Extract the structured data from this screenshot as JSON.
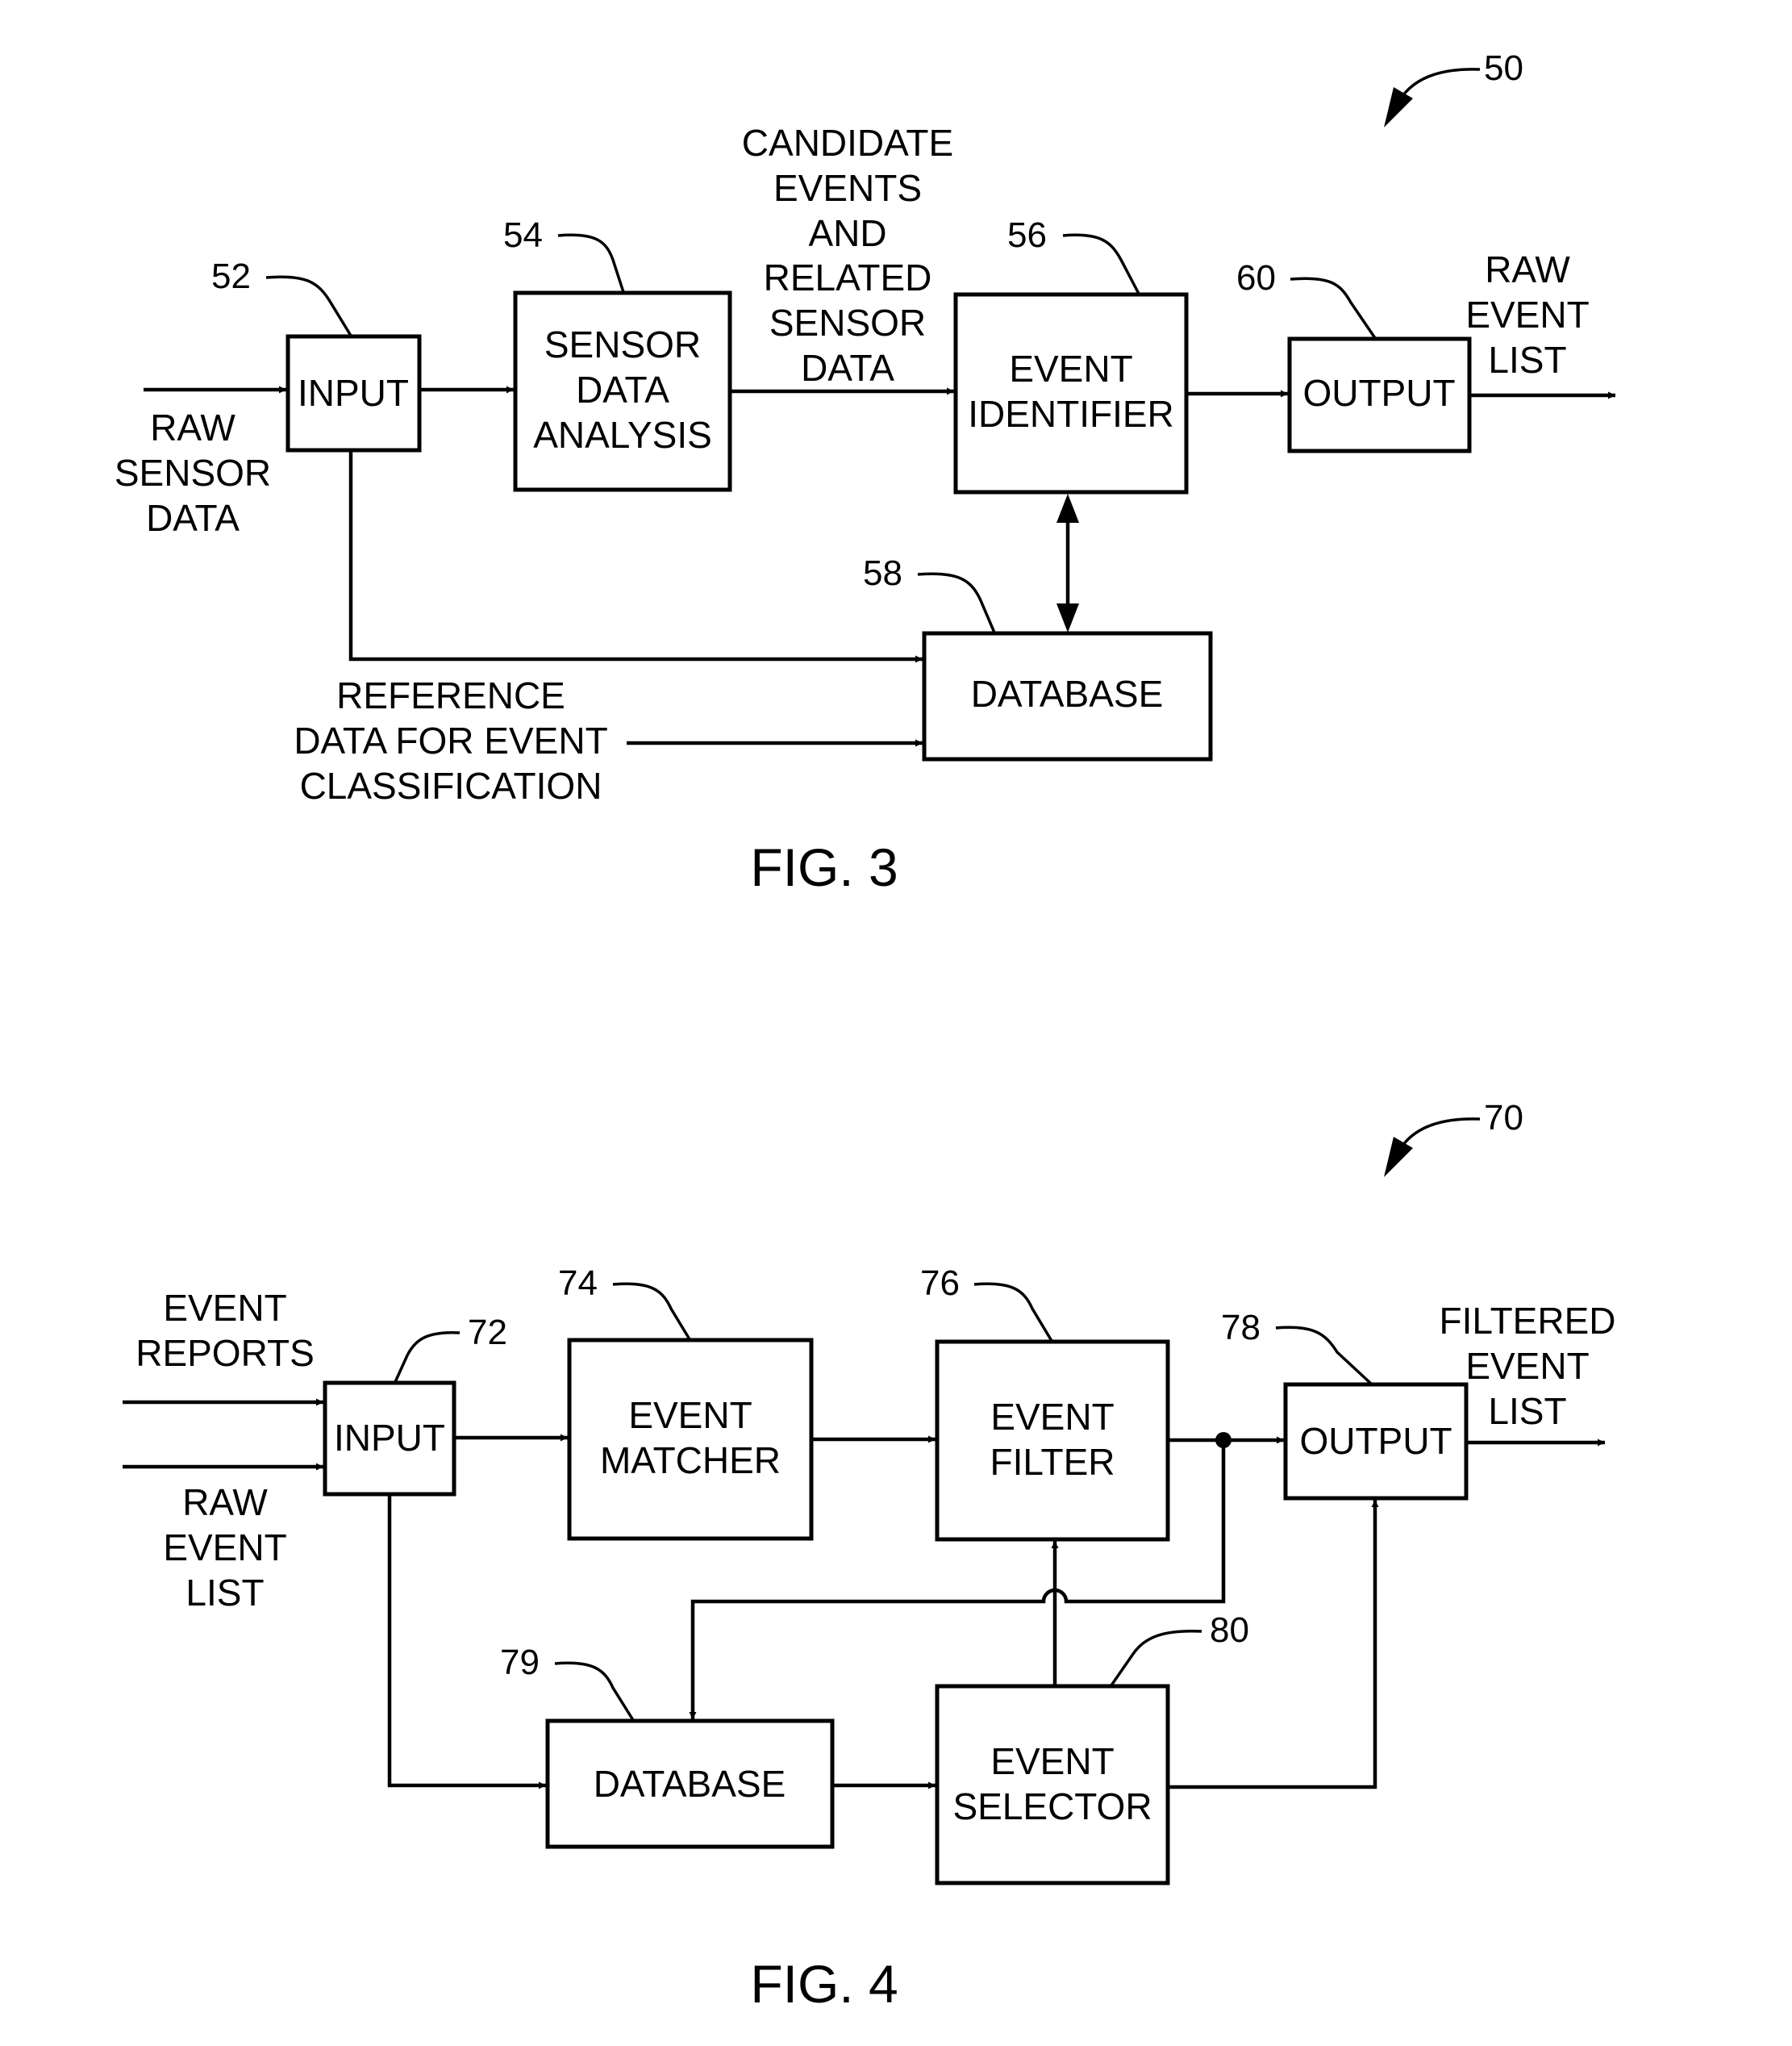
{
  "figures": [
    {
      "caption": "FIG. 3",
      "ref": "50",
      "blocks": {
        "input": {
          "ref": "52",
          "lines": [
            "INPUT"
          ]
        },
        "analysis": {
          "ref": "54",
          "lines": [
            "SENSOR",
            "DATA",
            "ANALYSIS"
          ]
        },
        "identifier": {
          "ref": "56",
          "lines": [
            "EVENT",
            "IDENTIFIER"
          ]
        },
        "database": {
          "ref": "58",
          "lines": [
            "DATABASE"
          ]
        },
        "output": {
          "ref": "60",
          "lines": [
            "OUTPUT"
          ]
        }
      },
      "labels": {
        "raw_sensor_data": [
          "RAW",
          "SENSOR",
          "DATA"
        ],
        "candidate_events": [
          "CANDIDATE",
          "EVENTS",
          "AND",
          "RELATED",
          "SENSOR",
          "DATA"
        ],
        "raw_event_list": [
          "RAW",
          "EVENT",
          "LIST"
        ],
        "reference_data": [
          "REFERENCE",
          "DATA FOR EVENT",
          "CLASSIFICATION"
        ]
      }
    },
    {
      "caption": "FIG. 4",
      "ref": "70",
      "blocks": {
        "input": {
          "ref": "72",
          "lines": [
            "INPUT"
          ]
        },
        "matcher": {
          "ref": "74",
          "lines": [
            "EVENT",
            "MATCHER"
          ]
        },
        "filter": {
          "ref": "76",
          "lines": [
            "EVENT",
            "FILTER"
          ]
        },
        "output": {
          "ref": "78",
          "lines": [
            "OUTPUT"
          ]
        },
        "database": {
          "ref": "79",
          "lines": [
            "DATABASE"
          ]
        },
        "selector": {
          "ref": "80",
          "lines": [
            "EVENT",
            "SELECTOR"
          ]
        }
      },
      "labels": {
        "event_reports": [
          "EVENT",
          "REPORTS"
        ],
        "raw_event_list": [
          "RAW",
          "EVENT",
          "LIST"
        ],
        "filtered_event_list": [
          "FILTERED",
          "EVENT",
          "LIST"
        ]
      }
    }
  ]
}
